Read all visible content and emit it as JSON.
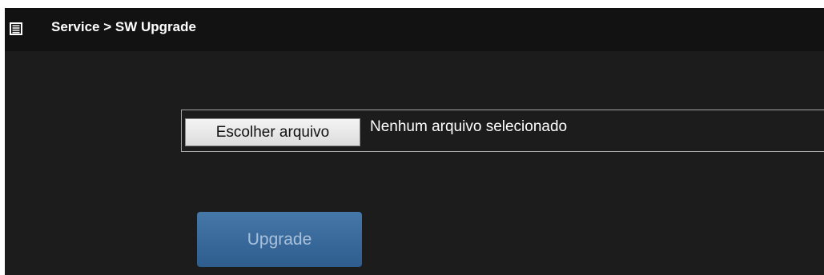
{
  "header": {
    "title": "Service > SW Upgrade",
    "icon": "menu-list-icon"
  },
  "file_input": {
    "button_label": "Escolher arquivo",
    "status_text": "Nenhum arquivo selecionado"
  },
  "actions": {
    "upgrade_label": "Upgrade"
  },
  "colors": {
    "header_bg": "#121212",
    "panel_bg": "#1c1c1c",
    "upgrade_button": "#3a6a9b",
    "upgrade_text": "#a9c1da"
  }
}
